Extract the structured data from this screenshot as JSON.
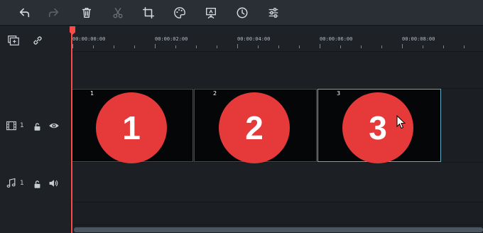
{
  "toolbar": {
    "items": [
      {
        "name": "undo",
        "icon": "undo-icon",
        "enabled": true
      },
      {
        "name": "redo",
        "icon": "redo-icon",
        "enabled": false
      },
      {
        "name": "delete",
        "icon": "trash-icon",
        "enabled": true
      },
      {
        "name": "cut",
        "icon": "scissors-icon",
        "enabled": false
      },
      {
        "name": "crop",
        "icon": "crop-icon",
        "enabled": true
      },
      {
        "name": "color",
        "icon": "palette-icon",
        "enabled": true
      },
      {
        "name": "presentation",
        "icon": "presentation-icon",
        "enabled": true
      },
      {
        "name": "speed",
        "icon": "clock-icon",
        "enabled": true
      },
      {
        "name": "adjust",
        "icon": "sliders-icon",
        "enabled": true
      }
    ]
  },
  "left_panel": {
    "add_track_icon": "add-track-icon",
    "link_icon": "link-icon",
    "video_track": {
      "number": "1",
      "icon": "film-icon",
      "lock_icon": "unlock-icon",
      "visibility_icon": "eye-icon"
    },
    "audio_track": {
      "number": "1",
      "icon": "music-note-icon",
      "lock_icon": "unlock-icon",
      "volume_icon": "speaker-icon"
    }
  },
  "ruler": {
    "labels": [
      "00:00:00:00",
      "00:00:02:00",
      "00:00:04:00",
      "00:00:06:00",
      "00:00:08:00"
    ]
  },
  "clips": [
    {
      "number": "1",
      "text": "1"
    },
    {
      "number": "2",
      "text": "2"
    },
    {
      "number": "3",
      "text": "3"
    }
  ],
  "colors": {
    "playhead": "#ff4a4a",
    "clip_circle": "#e63a3a",
    "clip_border": "#2f4e73",
    "clip_border_active": "#5fb3c7",
    "toolbar_bg": "#2a2f35"
  }
}
